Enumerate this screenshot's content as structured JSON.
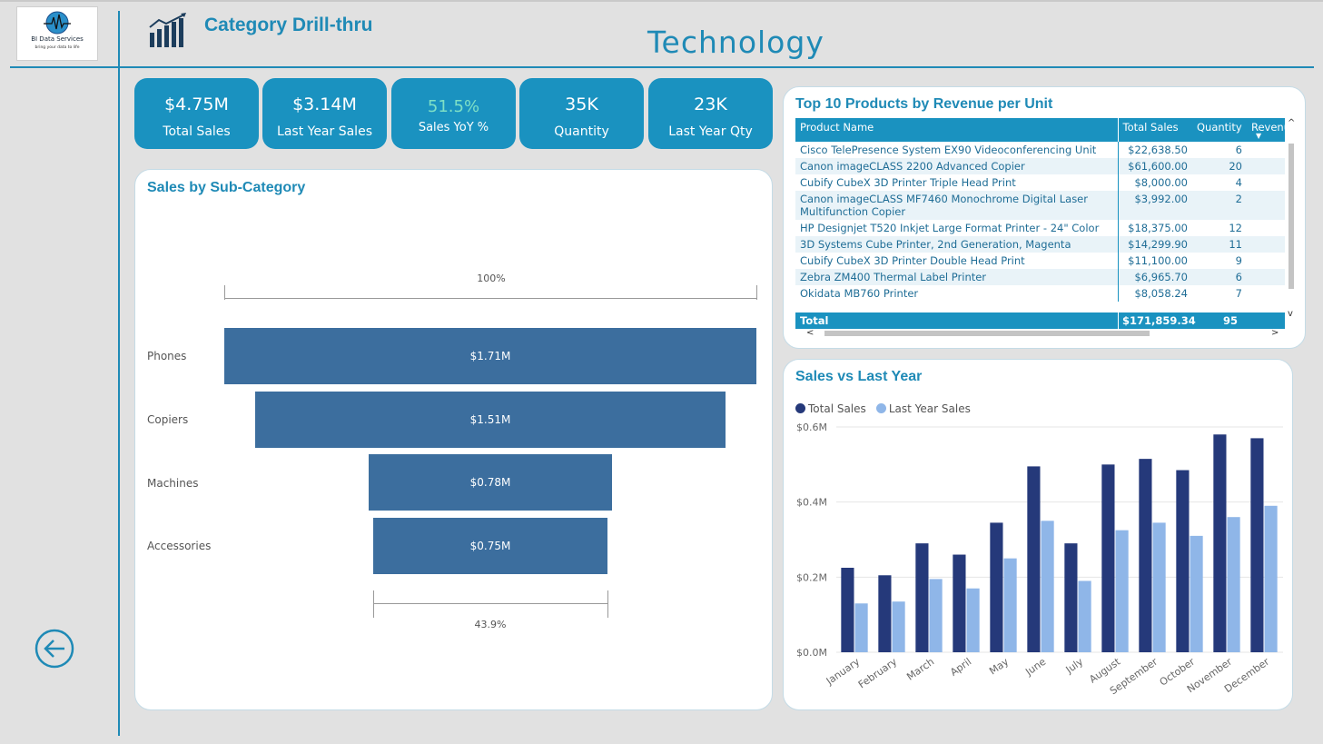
{
  "logo": {
    "name": "BI Data Services",
    "tagline": "bring your data to life"
  },
  "header": {
    "page_title": "Category Drill-thru",
    "category": "Technology"
  },
  "kpis": [
    {
      "value": "$4.75M",
      "label": "Total Sales"
    },
    {
      "value": "$3.14M",
      "label": "Last Year Sales"
    },
    {
      "value": "51.5%",
      "label": "Sales YoY %"
    },
    {
      "value": "35K",
      "label": "Quantity"
    },
    {
      "value": "23K",
      "label": "Last Year Qty"
    }
  ],
  "colors": {
    "accent": "#1a92c0",
    "yoy_value": "#7ee0c6",
    "funnel": "#3c6e9e",
    "total_sales": "#25397a",
    "last_year_sales": "#8fb6e8"
  },
  "funnel": {
    "title": "Sales by Sub-Category",
    "top_pct": "100%",
    "bottom_pct": "43.9%",
    "items": [
      {
        "category": "Phones",
        "label": "$1.71M",
        "value": 1.71
      },
      {
        "category": "Copiers",
        "label": "$1.51M",
        "value": 1.51
      },
      {
        "category": "Machines",
        "label": "$0.78M",
        "value": 0.78
      },
      {
        "category": "Accessories",
        "label": "$0.75M",
        "value": 0.75
      }
    ]
  },
  "top_products": {
    "title": "Top 10 Products by Revenue per Unit",
    "columns": [
      "Product Name",
      "Total Sales",
      "Quantity",
      "Revenue per Unit"
    ],
    "rows": [
      [
        "Cisco TelePresence System EX90 Videoconferencing Unit",
        "$22,638.50",
        "6"
      ],
      [
        "Canon imageCLASS 2200 Advanced Copier",
        "$61,600.00",
        "20"
      ],
      [
        "Cubify CubeX 3D Printer Triple Head Print",
        "$8,000.00",
        "4"
      ],
      [
        "Canon imageCLASS MF7460 Monochrome Digital Laser Multifunction Copier",
        "$3,992.00",
        "2"
      ],
      [
        "HP Designjet T520 Inkjet Large Format Printer - 24\" Color",
        "$18,375.00",
        "12"
      ],
      [
        "3D Systems Cube Printer, 2nd Generation, Magenta",
        "$14,299.90",
        "11"
      ],
      [
        "Cubify CubeX 3D Printer Double Head Print",
        "$11,100.00",
        "9"
      ],
      [
        "Zebra ZM400 Thermal Label Printer",
        "$6,965.70",
        "6"
      ],
      [
        "Okidata MB760 Printer",
        "$8,058.24",
        "7"
      ]
    ],
    "total": {
      "label": "Total",
      "sales": "$171,859.34",
      "qty": "95"
    }
  },
  "chart_data": {
    "type": "bar",
    "title": "Sales vs Last Year",
    "categories": [
      "January",
      "February",
      "March",
      "April",
      "May",
      "June",
      "July",
      "August",
      "September",
      "October",
      "November",
      "December"
    ],
    "series": [
      {
        "name": "Total Sales",
        "values": [
          0.225,
          0.205,
          0.29,
          0.26,
          0.345,
          0.495,
          0.29,
          0.5,
          0.515,
          0.485,
          0.58,
          0.57
        ]
      },
      {
        "name": "Last Year Sales",
        "values": [
          0.13,
          0.135,
          0.195,
          0.17,
          0.25,
          0.35,
          0.19,
          0.325,
          0.345,
          0.31,
          0.36,
          0.39
        ]
      }
    ],
    "yticks": [
      "$0.0M",
      "$0.2M",
      "$0.4M",
      "$0.6M"
    ],
    "ylim": [
      0,
      0.6
    ],
    "xlabel": "",
    "ylabel": "",
    "legend": "top-left",
    "grid": true
  }
}
